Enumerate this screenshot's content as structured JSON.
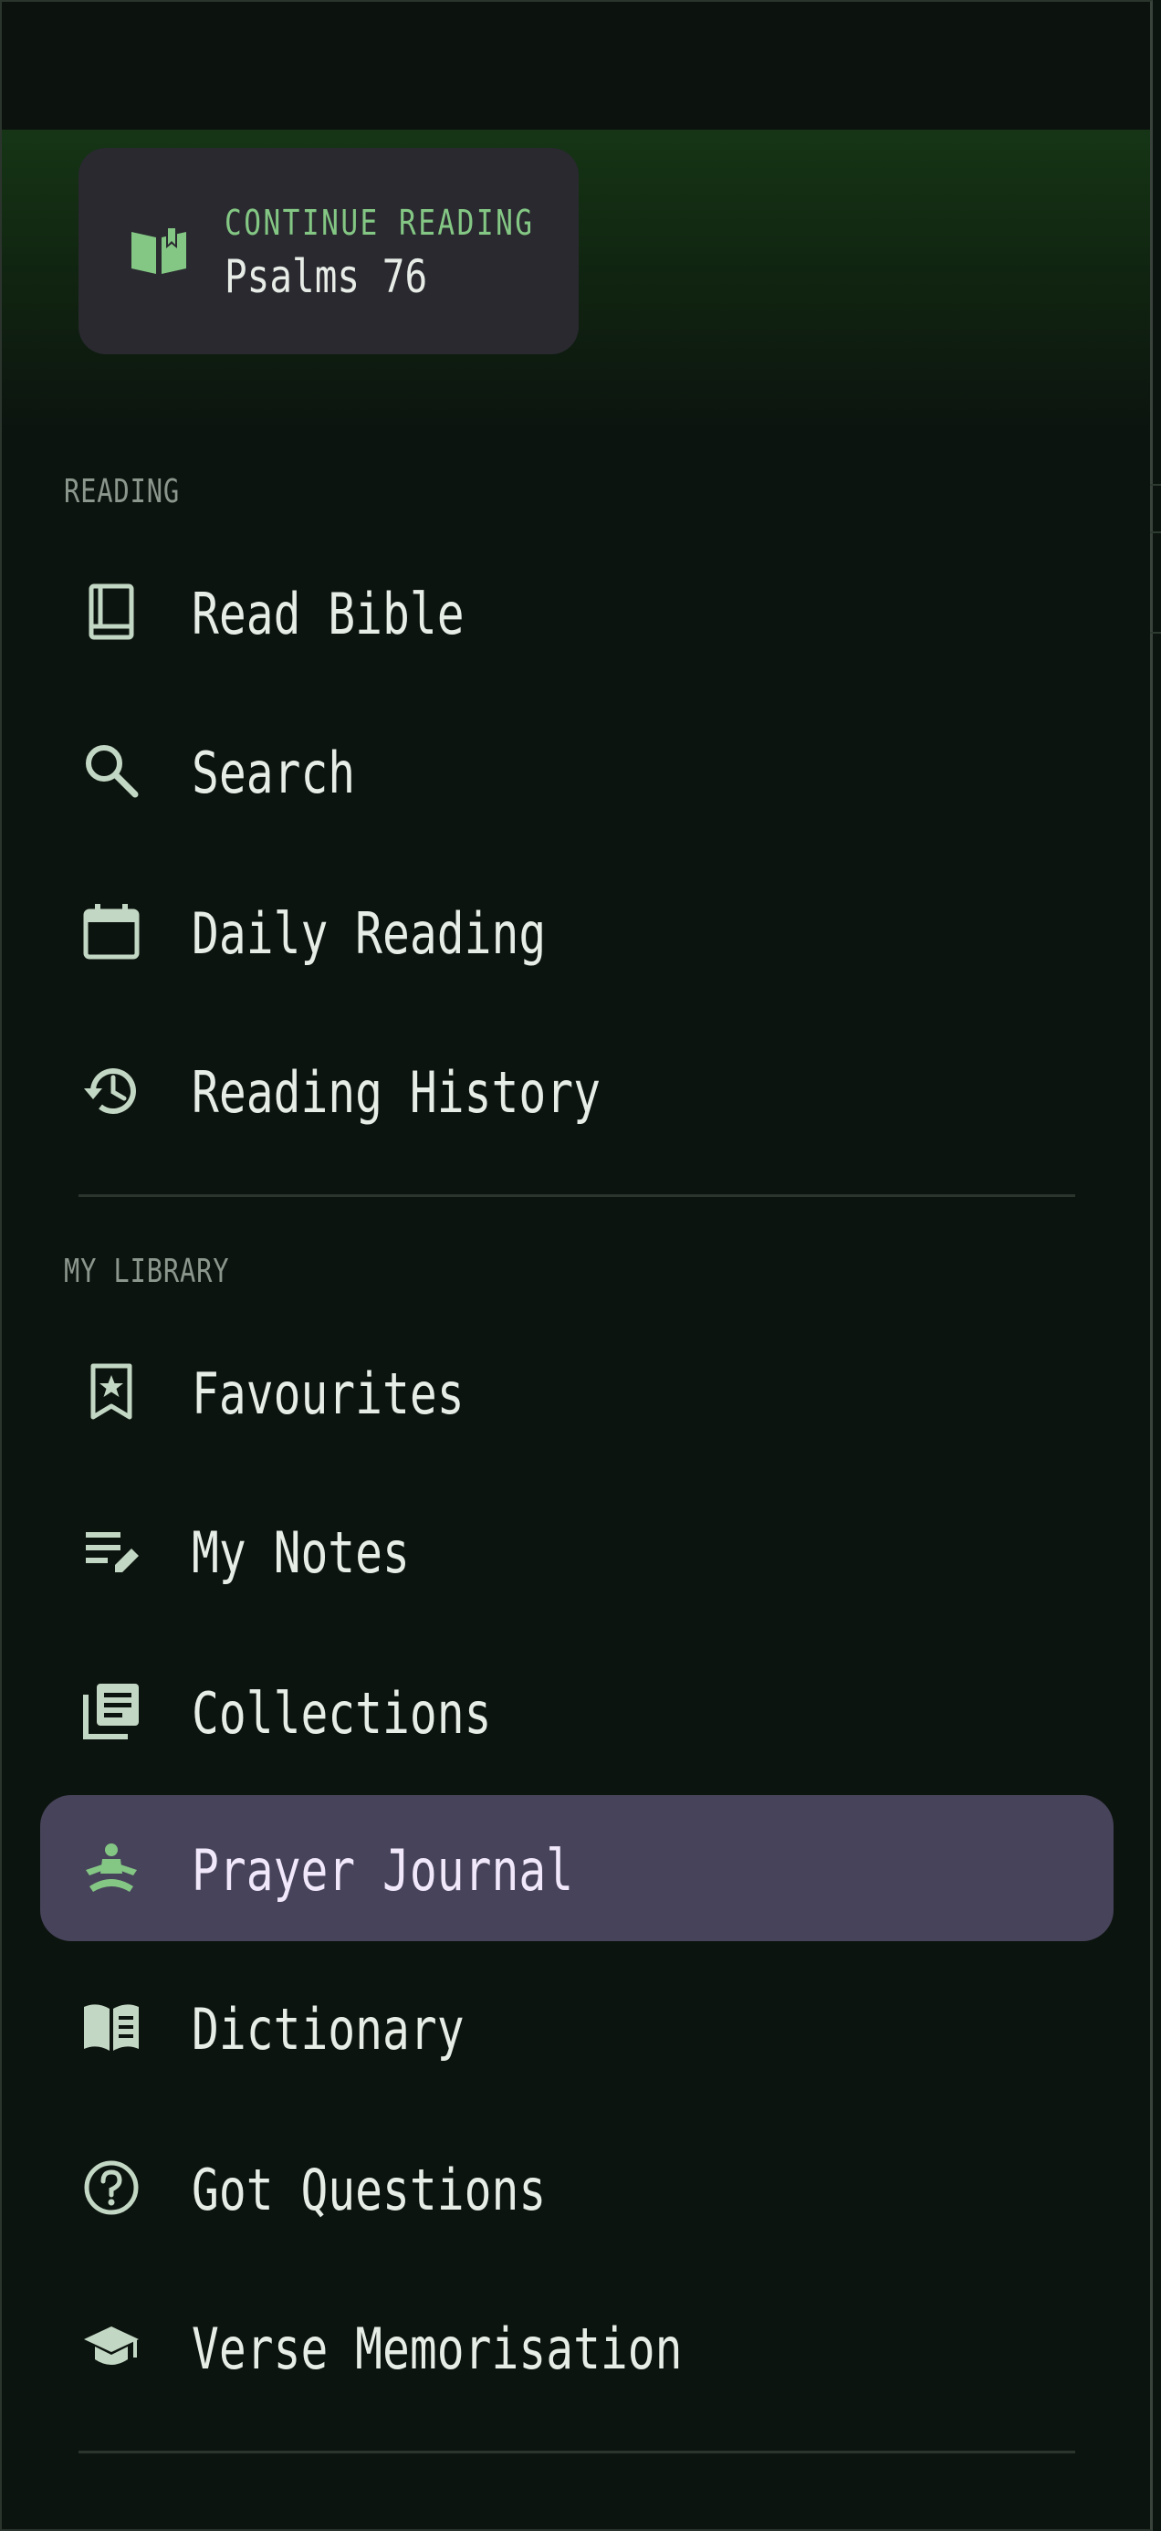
{
  "continue_reading": {
    "kicker": "CONTINUE READING",
    "title": "Psalms 76",
    "icon": "open-book-icon"
  },
  "sections": {
    "reading": "READING",
    "library": "MY LIBRARY"
  },
  "nav": {
    "read_bible": {
      "label": "Read Bible",
      "icon": "book-icon"
    },
    "search": {
      "label": "Search",
      "icon": "search-icon"
    },
    "daily_reading": {
      "label": "Daily Reading",
      "icon": "calendar-icon"
    },
    "reading_history": {
      "label": "Reading History",
      "icon": "history-icon"
    },
    "favourites": {
      "label": "Favourites",
      "icon": "bookmark-star-icon"
    },
    "my_notes": {
      "label": "My Notes",
      "icon": "edit-note-icon"
    },
    "collections": {
      "label": "Collections",
      "icon": "library-books-icon"
    },
    "prayer_journal": {
      "label": "Prayer Journal",
      "icon": "meditation-icon",
      "active": true
    },
    "dictionary": {
      "label": "Dictionary",
      "icon": "menu-book-icon"
    },
    "got_questions": {
      "label": "Got Questions",
      "icon": "help-circle-icon"
    },
    "verse_memorisation": {
      "label": "Verse Memorisation",
      "icon": "school-icon"
    }
  },
  "colors": {
    "background": "#0c140f",
    "header_accent": "#163516",
    "card": "#29292f",
    "accent_green": "#84c784",
    "active_item": "#47435a",
    "icon": "#c3d8c4"
  }
}
